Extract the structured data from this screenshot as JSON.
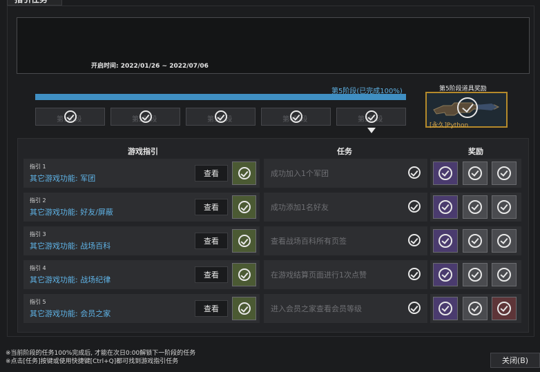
{
  "window": {
    "title": "指引任务"
  },
  "open_time": "开启时间: 2022/01/26 ~ 2022/07/06",
  "stage": {
    "label": "第5阶段(已完成100%)",
    "progress_percent": 100,
    "buttons": [
      {
        "label": "第1阶段"
      },
      {
        "label": "第2阶段"
      },
      {
        "label": "第3阶段"
      },
      {
        "label": "第4阶段"
      },
      {
        "label": "第5阶段"
      }
    ]
  },
  "stage_reward": {
    "title": "第5阶段道具奖励",
    "item_name": "[永久]Python"
  },
  "table": {
    "headers": {
      "guide": "游戏指引",
      "task": "任务",
      "reward": "奖励"
    },
    "view_label": "查看",
    "rows": [
      {
        "num": "指引 1",
        "name": "其它游戏功能: 军团",
        "task": "成功加入1个军团",
        "rewards": [
          "purple",
          "gray",
          "gray"
        ]
      },
      {
        "num": "指引 2",
        "name": "其它游戏功能: 好友/屏蔽",
        "task": "成功添加1名好友",
        "rewards": [
          "purple",
          "gray",
          "gray"
        ]
      },
      {
        "num": "指引 3",
        "name": "其它游戏功能: 战场百科",
        "task": "查看战场百科所有页签",
        "rewards": [
          "purple",
          "gray",
          "gray"
        ]
      },
      {
        "num": "指引 4",
        "name": "其它游戏功能: 战场纪律",
        "task": "在游戏结算页面进行1次点赞",
        "rewards": [
          "purple",
          "gray",
          "gray"
        ]
      },
      {
        "num": "指引 5",
        "name": "其它游戏功能: 会员之家",
        "task": "进入会员之家查看会员等级",
        "rewards": [
          "purple",
          "gray",
          "red"
        ]
      }
    ]
  },
  "footer": {
    "note1": "※当前阶段的任务100%完成后, 才能在次日0:00解锁下一阶段的任务",
    "note2": "※点击[任务]按键或使用快捷键[Ctrl+Q]都可找到游戏指引任务"
  },
  "close_label": "关闭(B)",
  "colors": {
    "accent": "#3f8fc3",
    "guide_text": "#5fb3e6",
    "reward_border": "#b58a2b"
  }
}
